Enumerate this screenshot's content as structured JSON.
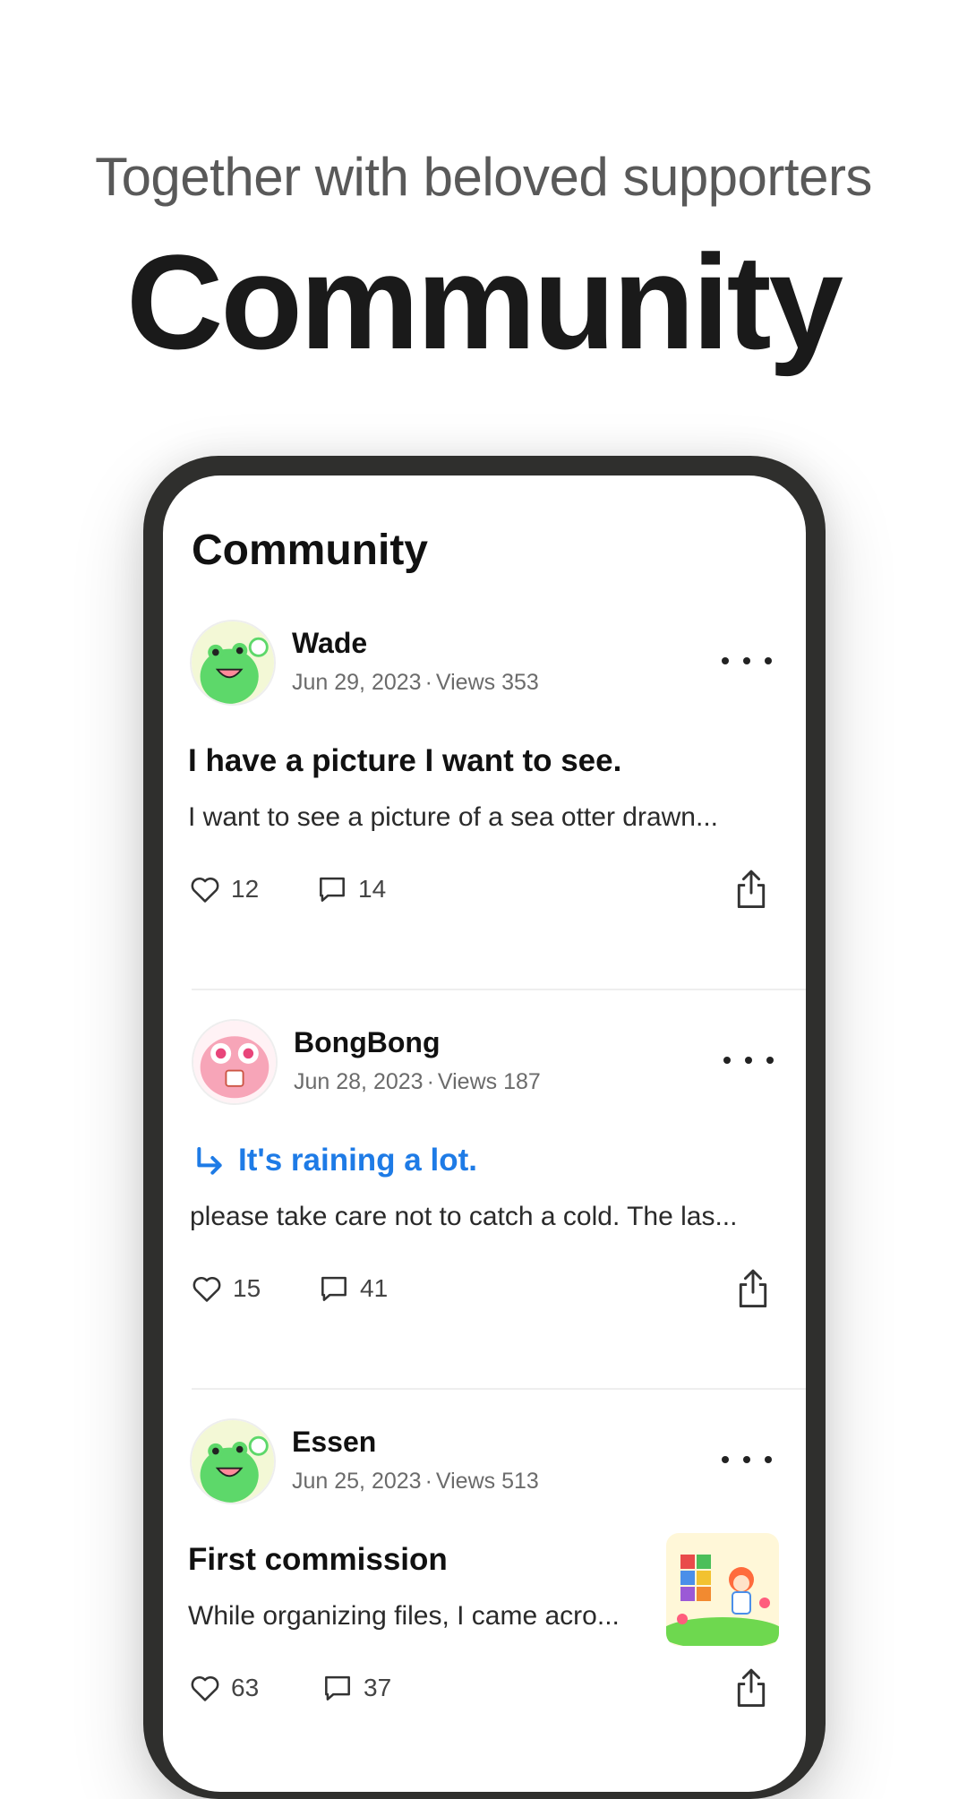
{
  "hero": {
    "tagline": "Together with beloved supporters",
    "title": "Community"
  },
  "screen": {
    "title": "Community"
  },
  "posts": [
    {
      "author": "Wade",
      "date": "Jun 29, 2023",
      "views": "Views 353",
      "title": "I have a picture I want to see.",
      "body": "I want to see a picture of a sea otter drawn...",
      "likes": "12",
      "comments": "14",
      "avatar": "green-frog-avatar"
    },
    {
      "author": "BongBong",
      "date": "Jun 28, 2023",
      "views": "Views 187",
      "title": "It's raining a lot.",
      "body": "please take care not to catch a cold. The las...",
      "likes": "15",
      "comments": "41",
      "avatar": "pink-creature-avatar",
      "is_reply": true
    },
    {
      "author": "Essen",
      "date": "Jun 25, 2023",
      "views": "Views 513",
      "title": "First commission",
      "body": "While organizing files, I came acro...",
      "likes": "63",
      "comments": "37",
      "avatar": "green-frog-avatar",
      "thumbnail": "illustration-thumbnail"
    }
  ],
  "colors": {
    "phone_frame": "#2f2f2d",
    "reply_accent": "#1e7be6",
    "tagline": "#595959"
  },
  "icons": {
    "like": "heart-icon",
    "comment": "comment-icon",
    "share": "share-icon",
    "more": "more-icon",
    "reply": "reply-arrow-icon"
  }
}
